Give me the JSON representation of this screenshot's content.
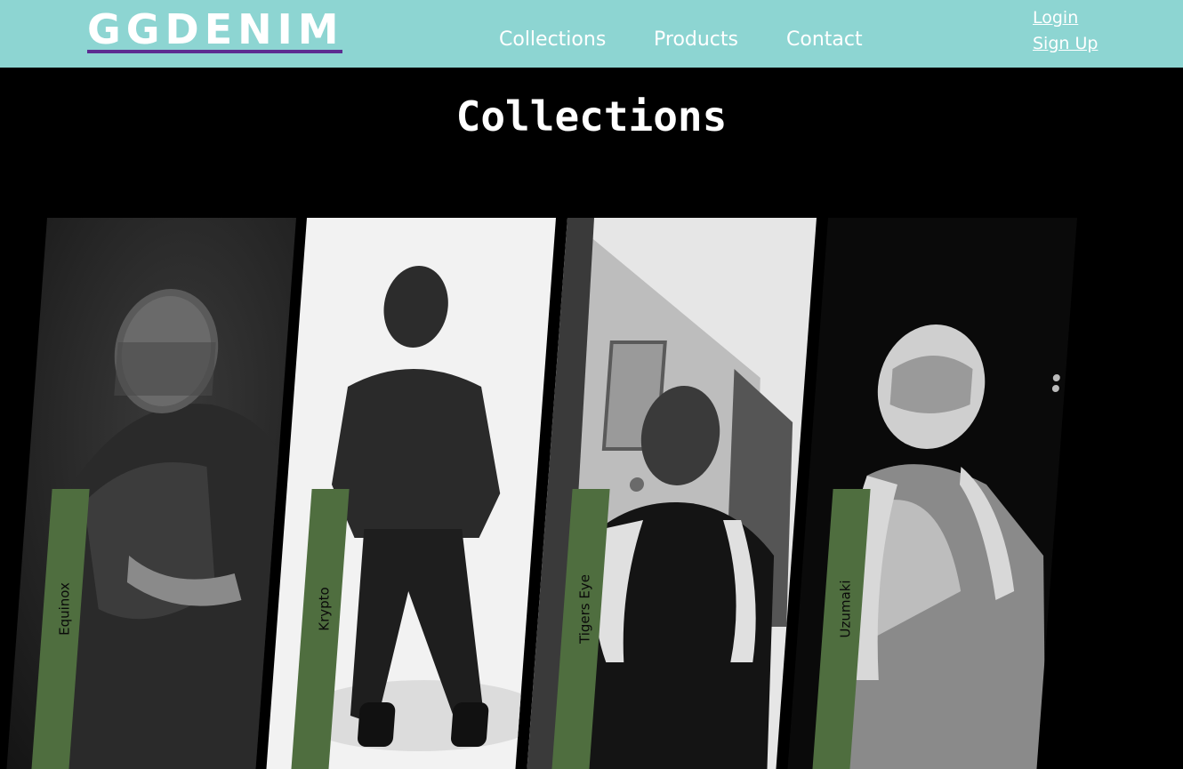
{
  "header": {
    "logo": "GGDENIM",
    "nav": {
      "collections": "Collections",
      "products": "Products",
      "contact": "Contact"
    },
    "auth": {
      "login": "Login",
      "signup": "Sign Up"
    }
  },
  "main": {
    "title": "Collections",
    "collections": [
      {
        "label": "Equinox"
      },
      {
        "label": "Krypto"
      },
      {
        "label": "Tigers Eye"
      },
      {
        "label": "Uzumaki"
      }
    ]
  },
  "colors": {
    "header_bg": "#8dd5d2",
    "logo_underline": "#5c2d91",
    "band_green": "#4f6e3f",
    "page_bg": "#000000"
  }
}
